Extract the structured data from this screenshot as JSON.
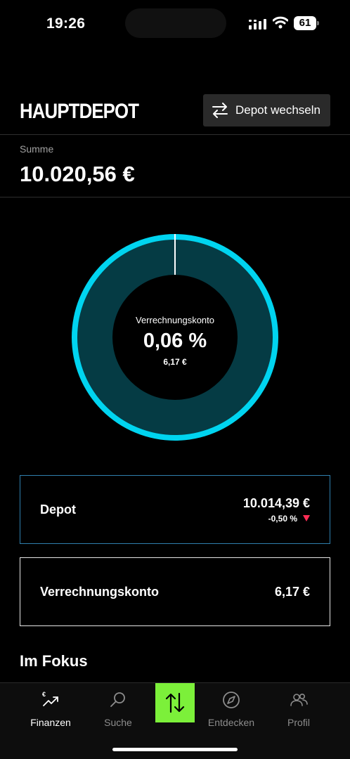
{
  "status": {
    "time": "19:26",
    "battery": "61"
  },
  "header": {
    "title": "HAUPTDEPOT",
    "switch_label": "Depot wechseln"
  },
  "summary": {
    "label": "Summe",
    "value": "10.020,56 €"
  },
  "allocation": {
    "center_label": "Verrechnungskonto",
    "center_percent": "0,06 %",
    "center_amount": "6,17 €",
    "depot_share": 0.9994,
    "cash_share": 0.0006,
    "colors": {
      "ring": "#00d4f0",
      "fill": "#053b44",
      "separator": "#ffffff"
    }
  },
  "accounts": [
    {
      "name": "Depot",
      "amount": "10.014,39 €",
      "change": "-0,50 %",
      "trend": "down"
    },
    {
      "name": "Verrechnungskonto",
      "amount": "6,17 €"
    }
  ],
  "focus": {
    "title": "Im Fokus"
  },
  "tabs": [
    {
      "label": "Finanzen",
      "icon": "finance-chart-icon",
      "active": true
    },
    {
      "label": "Suche",
      "icon": "search-icon",
      "active": false
    },
    {
      "label": "Entdecken",
      "icon": "compass-icon",
      "active": false
    },
    {
      "label": "Profil",
      "icon": "people-icon",
      "active": false
    }
  ],
  "trade": {
    "icon": "swap-vertical-icon",
    "color": "#7cf03a"
  }
}
